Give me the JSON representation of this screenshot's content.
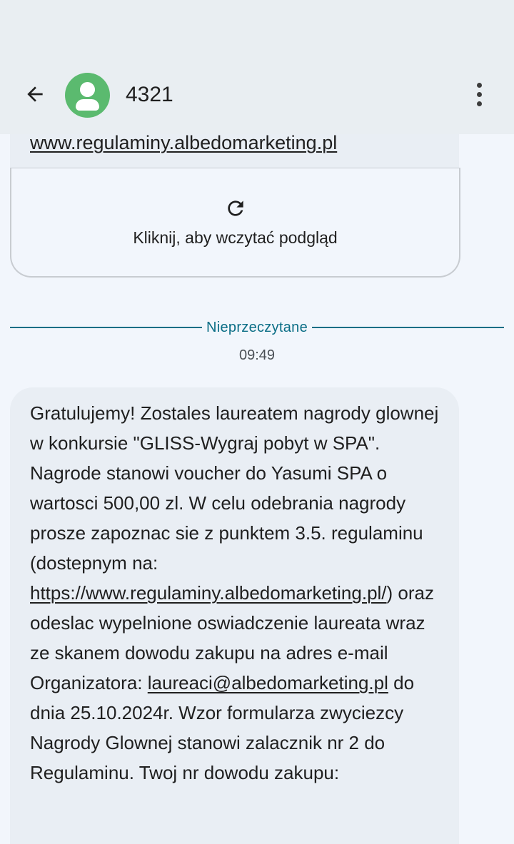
{
  "header": {
    "back_icon": "arrow-left-icon",
    "avatar_icon": "person-icon",
    "avatar_color": "#5bba6f",
    "contact_name": "4321",
    "more_icon": "more-vert-icon"
  },
  "thread": {
    "previous_message": {
      "link_text": "www.regulaminy.albedomarketing.pl"
    },
    "link_preview": {
      "icon": "refresh-icon",
      "label": "Kliknij, aby wczytać podgląd"
    },
    "unread_divider": {
      "label": "Nieprzeczytane",
      "color": "#0b6e86"
    },
    "timestamp": "09:49",
    "message": {
      "part1": "Gratulujemy! Zostales laureatem nagrody glownej w konkursie \"GLISS-Wygraj pobyt w SPA\". Nagrode stanowi voucher do Yasumi SPA o wartosci 500,00 zl. W celu odebrania nagrody prosze zapoznac sie z punktem 3.5. regulaminu (dostepnym na: ",
      "link1": "https://www.regulaminy.albedomarketing.pl/",
      "part2": ") oraz odeslac wypelnione oswiadczenie laureata wraz ze skanem dowodu zakupu na adres e-mail Organizatora: ",
      "link2": "laureaci@albedomarketing.pl",
      "part3": " do dnia 25.10.2024r. Wzor formularza zwyciezcy Nagrody Glownej stanowi zalacznik nr 2 do Regulaminu. Twoj nr dowodu zakupu:"
    }
  }
}
